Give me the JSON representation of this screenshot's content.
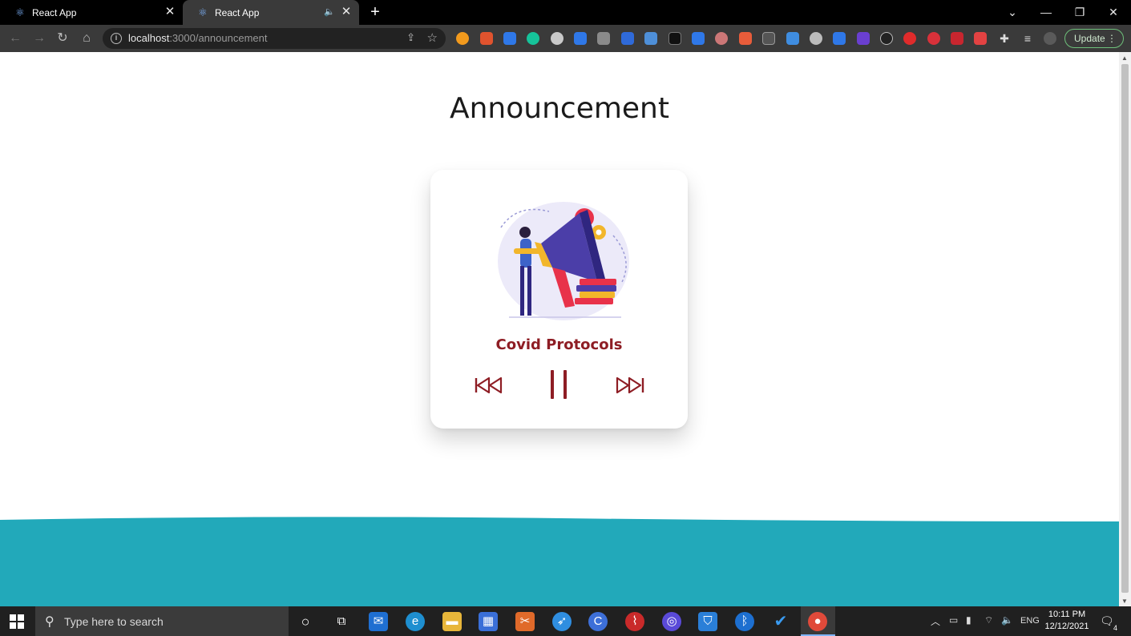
{
  "browser": {
    "tabs": [
      {
        "title": "React App"
      },
      {
        "title": "React App"
      }
    ],
    "url_host": "localhost",
    "url_rest": ":3000/announcement",
    "update_label": "Update"
  },
  "page": {
    "heading": "Announcement",
    "player": {
      "track_title": "Covid Protocols",
      "state": "playing"
    }
  },
  "taskbar": {
    "search_placeholder": "Type here to search",
    "tray": {
      "language": "ENG",
      "time": "10:11 PM",
      "date": "12/12/2021",
      "notification_count": "4"
    }
  },
  "colors": {
    "accent": "#8e1d24",
    "wave": "#22a9ba",
    "chrome_dark": "#3a3a3a"
  }
}
